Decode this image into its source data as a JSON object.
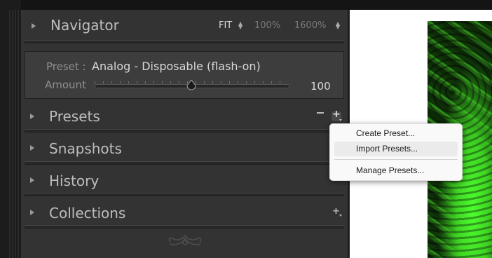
{
  "navigator": {
    "title": "Navigator",
    "zoom_options": [
      "FIT",
      "100%",
      "1600%"
    ],
    "selected_zoom": "FIT"
  },
  "preset_box": {
    "preset_label": "Preset :",
    "preset_value": "Analog - Disposable (flash-on)",
    "amount_label": "Amount",
    "amount_value": "100"
  },
  "sections": [
    {
      "title": "Presets"
    },
    {
      "title": "Snapshots"
    },
    {
      "title": "History"
    },
    {
      "title": "Collections"
    }
  ],
  "context_menu": {
    "items": [
      "Create Preset...",
      "Import Presets...",
      "Manage Presets..."
    ],
    "hovered": "Import Presets..."
  },
  "icons": {
    "expand": "triangle-right-icon",
    "remove": "minus-icon",
    "add": "plus-icon",
    "ornament": "panel-end-ornament-icon"
  },
  "colors": {
    "panel_bg": "#333333",
    "title_text": "#bdbdbd",
    "menu_bg": "#f9f9f9",
    "photo_green": "#3fd424"
  }
}
